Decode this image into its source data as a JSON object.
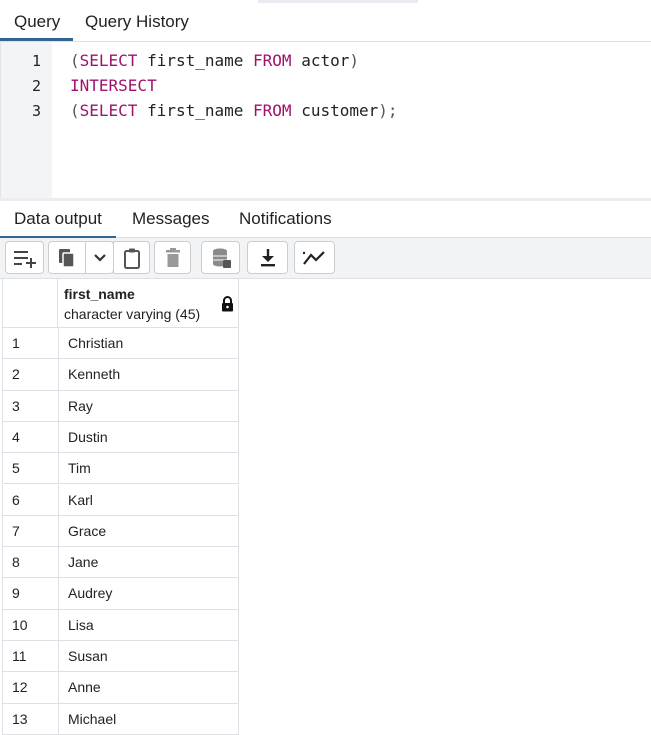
{
  "tabs": {
    "query": "Query",
    "history": "Query History"
  },
  "editor": {
    "lines": [
      {
        "num": "1",
        "open": "(",
        "kw1": "SELECT",
        "mid": " first_name ",
        "kw2": "FROM",
        "tail": " actor",
        "close": ")"
      },
      {
        "num": "2",
        "kw": "INTERSECT"
      },
      {
        "num": "3",
        "open": "(",
        "kw1": "SELECT",
        "mid": " first_name ",
        "kw2": "FROM",
        "tail": " customer",
        "close": ");"
      }
    ]
  },
  "output_tabs": {
    "data": "Data output",
    "messages": "Messages",
    "notifications": "Notifications"
  },
  "toolbar": {
    "icons": [
      "add-row-icon",
      "copy-icon",
      "chevron-down-icon",
      "paste-icon",
      "delete-icon",
      "save-data-icon",
      "download-icon",
      "graph-icon"
    ]
  },
  "grid": {
    "column": {
      "name": "first_name",
      "type": "character varying (45)",
      "icon": "lock-icon"
    },
    "rows": [
      {
        "num": "1",
        "value": "Christian"
      },
      {
        "num": "2",
        "value": "Kenneth"
      },
      {
        "num": "3",
        "value": "Ray"
      },
      {
        "num": "4",
        "value": "Dustin"
      },
      {
        "num": "5",
        "value": "Tim"
      },
      {
        "num": "6",
        "value": "Karl"
      },
      {
        "num": "7",
        "value": "Grace"
      },
      {
        "num": "8",
        "value": "Jane"
      },
      {
        "num": "9",
        "value": "Audrey"
      },
      {
        "num": "10",
        "value": "Lisa"
      },
      {
        "num": "11",
        "value": "Susan"
      },
      {
        "num": "12",
        "value": "Anne"
      },
      {
        "num": "13",
        "value": "Michael"
      }
    ]
  },
  "colors": {
    "keyword": "#a0116e",
    "active_tab": "#326690"
  }
}
